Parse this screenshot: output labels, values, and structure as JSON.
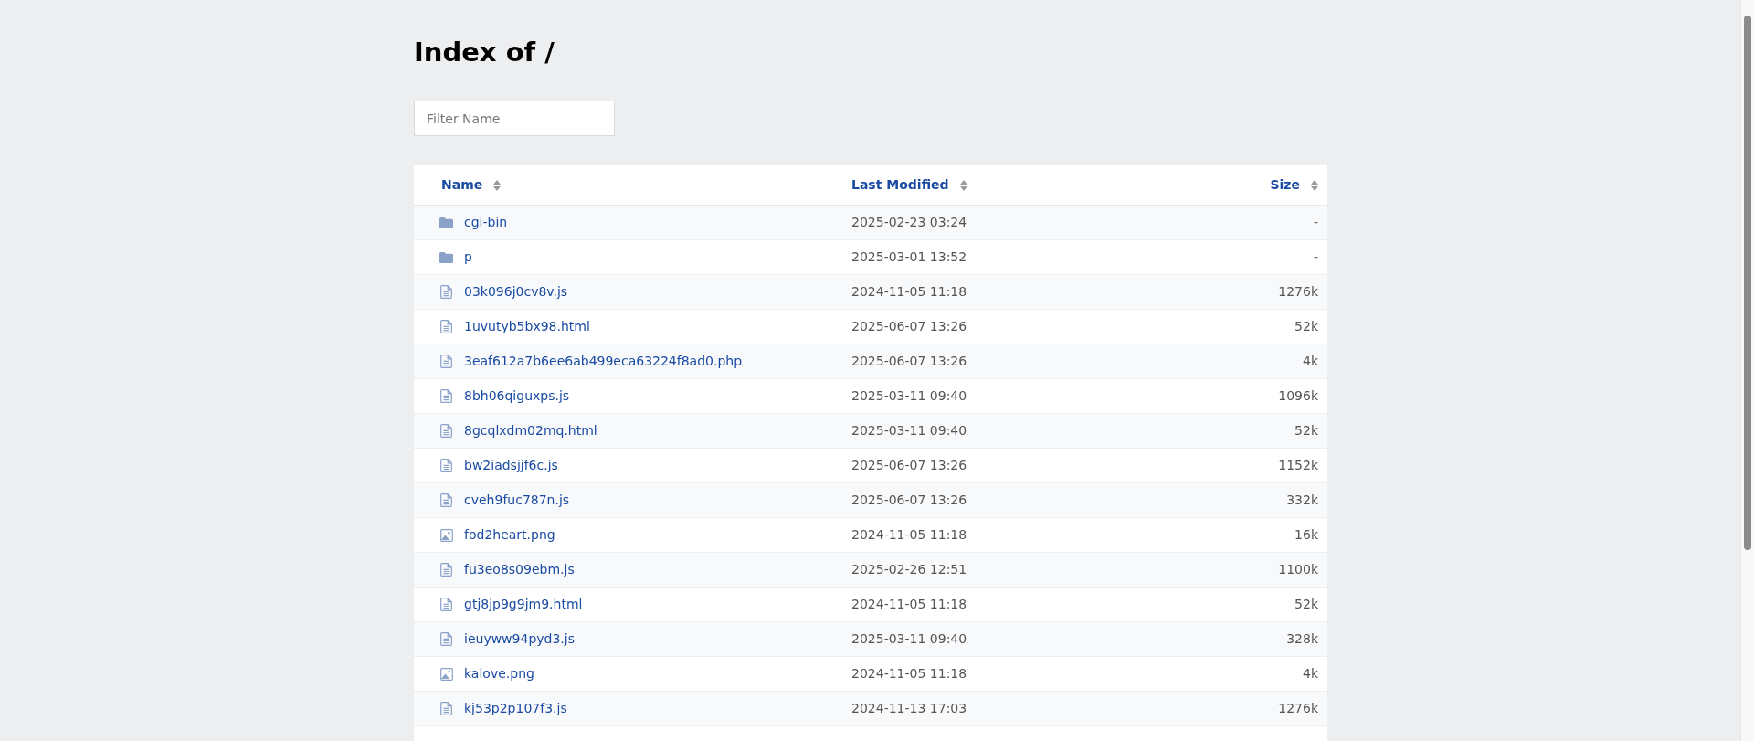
{
  "title": "Index of /",
  "filter": {
    "placeholder": "Filter Name"
  },
  "columns": [
    {
      "label": "Name"
    },
    {
      "label": "Last Modified"
    },
    {
      "label": "Size"
    }
  ],
  "rows": [
    {
      "kind": "folder",
      "name": "cgi-bin",
      "modified": "2025-02-23 03:24",
      "size": "-"
    },
    {
      "kind": "folder",
      "name": "p",
      "modified": "2025-03-01 13:52",
      "size": "-"
    },
    {
      "kind": "file",
      "name": "03k096j0cv8v.js",
      "modified": "2024-11-05 11:18",
      "size": "1276k"
    },
    {
      "kind": "file",
      "name": "1uvutyb5bx98.html",
      "modified": "2025-06-07 13:26",
      "size": "52k"
    },
    {
      "kind": "file",
      "name": "3eaf612a7b6ee6ab499eca63224f8ad0.php",
      "modified": "2025-06-07 13:26",
      "size": "4k"
    },
    {
      "kind": "file",
      "name": "8bh06qiguxps.js",
      "modified": "2025-03-11 09:40",
      "size": "1096k"
    },
    {
      "kind": "file",
      "name": "8gcqlxdm02mq.html",
      "modified": "2025-03-11 09:40",
      "size": "52k"
    },
    {
      "kind": "file",
      "name": "bw2iadsjjf6c.js",
      "modified": "2025-06-07 13:26",
      "size": "1152k"
    },
    {
      "kind": "file",
      "name": "cveh9fuc787n.js",
      "modified": "2025-06-07 13:26",
      "size": "332k"
    },
    {
      "kind": "image",
      "name": "fod2heart.png",
      "modified": "2024-11-05 11:18",
      "size": "16k"
    },
    {
      "kind": "file",
      "name": "fu3eo8s09ebm.js",
      "modified": "2025-02-26 12:51",
      "size": "1100k"
    },
    {
      "kind": "file",
      "name": "gtj8jp9g9jm9.html",
      "modified": "2024-11-05 11:18",
      "size": "52k"
    },
    {
      "kind": "file",
      "name": "ieuyww94pyd3.js",
      "modified": "2025-03-11 09:40",
      "size": "328k"
    },
    {
      "kind": "image",
      "name": "kalove.png",
      "modified": "2024-11-05 11:18",
      "size": "4k"
    },
    {
      "kind": "file",
      "name": "kj53p2p107f3.js",
      "modified": "2024-11-13 17:03",
      "size": "1276k"
    }
  ]
}
